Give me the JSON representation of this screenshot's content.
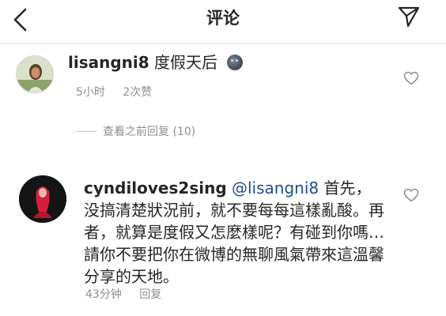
{
  "header": {
    "title": "评论"
  },
  "comments": [
    {
      "username": "lisangni8",
      "text": "度假天后",
      "emoji": "moon-face",
      "time": "5小时",
      "likes": "2次赞"
    },
    {
      "username": "cyndiloves2sing",
      "mention": "@lisangni8",
      "text": "首先，没搞清楚狀況前，就不要每每這樣亂酸。再者，就算是度假又怎麼樣呢？有碰到你嗎…  請你不要把你在微博的無聊風氣帶來這溫馨分享的天地。",
      "time": "43分钟",
      "reply_label": "回复"
    }
  ],
  "view_replies": {
    "label": "查看之前回复 (10)"
  },
  "colors": {
    "mention": "#1f4e87",
    "meta": "#8e8e8e",
    "text": "#262626"
  }
}
